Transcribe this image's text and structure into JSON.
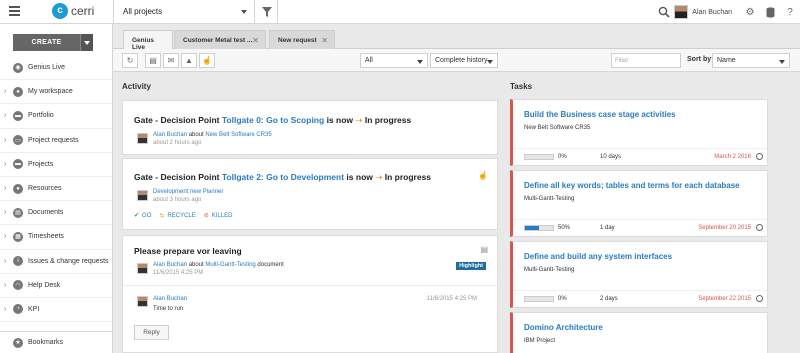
{
  "header": {
    "logo_text": "cerri",
    "project_select": "All projects",
    "user_name": "Alan Buchan"
  },
  "sidebar": {
    "create_label": "CREATE",
    "items": [
      {
        "label": "Genius Live",
        "icon": "broadcast-icon",
        "chevron": false
      },
      {
        "label": "My workspace",
        "icon": "person-icon",
        "chevron": true
      },
      {
        "label": "Portfolio",
        "icon": "folder-icon",
        "chevron": true
      },
      {
        "label": "Project requests",
        "icon": "inbox-icon",
        "chevron": true
      },
      {
        "label": "Projects",
        "icon": "folder-icon",
        "chevron": true
      },
      {
        "label": "Resources",
        "icon": "person-icon",
        "chevron": true
      },
      {
        "label": "Documents",
        "icon": "document-icon",
        "chevron": true
      },
      {
        "label": "Timesheets",
        "icon": "timesheet-icon",
        "chevron": true
      },
      {
        "label": "Issues & change requests",
        "icon": "info-icon",
        "chevron": true
      },
      {
        "label": "Help Desk",
        "icon": "headset-icon",
        "chevron": true
      },
      {
        "label": "KPI",
        "icon": "gauge-icon",
        "chevron": true
      }
    ],
    "bookmarks_label": "Bookmarks"
  },
  "tabs": [
    {
      "label": "Genius Live",
      "active": true,
      "closable": false
    },
    {
      "label": "Customer Metal test ...",
      "active": false,
      "closable": true
    },
    {
      "label": "New request",
      "active": false,
      "closable": true
    }
  ],
  "toolbar": {
    "scope_select": "All",
    "history_select": "Complete history",
    "filter_placeholder": "Filter",
    "sort_label": "Sort by",
    "sort_select": "Name"
  },
  "activity": {
    "title": "Activity",
    "cards": [
      {
        "prefix": "Gate - Decision Point",
        "link": "Tollgate 0: Go to Scoping",
        "mid": "is now",
        "status": "In progress",
        "author": "Alan Buchan",
        "about_word": "about",
        "about_link": "New Belt Software CR35",
        "time": "about 2 hours ago"
      },
      {
        "prefix": "Gate - Decision Point",
        "link": "Tollgate 2: Go to Development",
        "mid": "is now",
        "status": "In progress",
        "author": "Development new Planner",
        "time": "about 3 hours ago",
        "decisions": [
          "GO",
          "RECYCLE",
          "KILLED"
        ]
      },
      {
        "title": "Please prepare vor leaving",
        "author": "Alan Buchan",
        "about_word": "about",
        "about_link": "Multi-Gantt-Testing",
        "about_suffix": "document",
        "time": "11/6/2015 4:25 PM",
        "badge": "Highlight",
        "reply": {
          "author": "Alan Buchan",
          "text": "Time to run",
          "time": "11/6/2015 4:25 PM"
        },
        "reply_button": "Reply"
      }
    ]
  },
  "tasks": {
    "title": "Tasks",
    "items": [
      {
        "title": "Build the Business case stage activities",
        "project": "New Belt Software CR35",
        "progress": 0,
        "progress_label": "0%",
        "duration": "10 days",
        "due": "March 2 2016"
      },
      {
        "title": "Define all key words; tables and terms for each database",
        "project": "Multi-Gantt-Testing",
        "progress": 50,
        "progress_label": "50%",
        "duration": "1 day",
        "due": "September 20 2015"
      },
      {
        "title": "Define and build any system interfaces",
        "project": "Multi-Gantt-Testing",
        "progress": 0,
        "progress_label": "0%",
        "duration": "2 days",
        "due": "September 22 2015"
      },
      {
        "title": "Domino Architecture",
        "project": "IBM Project"
      }
    ]
  }
}
